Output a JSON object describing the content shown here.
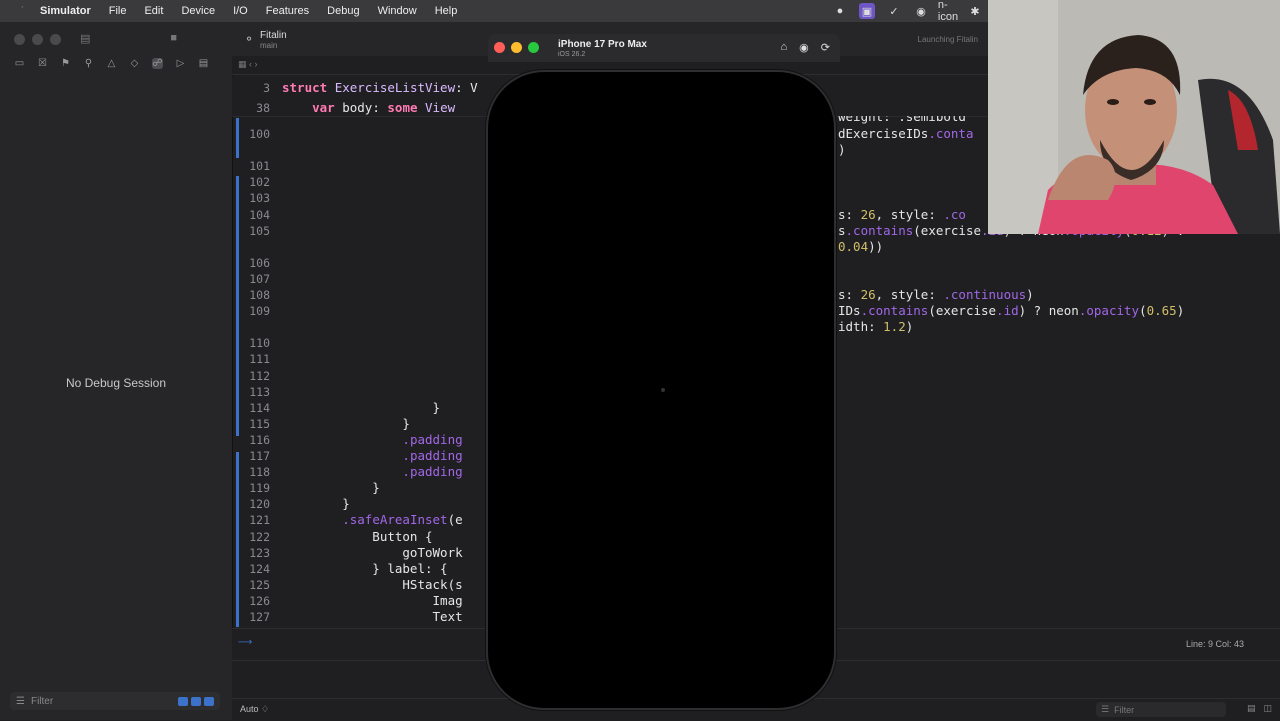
{
  "menubar": {
    "app": "Simulator",
    "items": [
      "File",
      "Edit",
      "Device",
      "I/O",
      "Features",
      "Debug",
      "Window",
      "Help"
    ],
    "status_icons": [
      "n-icon"
    ]
  },
  "navigator": {
    "no_debug": "No Debug Session",
    "filter_placeholder": "Filter"
  },
  "editor": {
    "project_name": "Fitalin",
    "branch": "main",
    "status": "Launching Fitalin",
    "sticky": [
      {
        "num": "3",
        "parts": [
          {
            "t": "struct ",
            "c": "kw"
          },
          {
            "t": "ExerciseListView",
            "c": "ty"
          },
          {
            "t": ": V",
            "c": ""
          }
        ]
      },
      {
        "num": "38",
        "parts": [
          {
            "t": "    var ",
            "c": "kw"
          },
          {
            "t": "body",
            "c": ""
          },
          {
            "t": ": ",
            "c": ""
          },
          {
            "t": "some ",
            "c": "kw"
          },
          {
            "t": "View",
            "c": "ty"
          }
        ]
      }
    ],
    "lines": [
      {
        "num": "100",
        "left": "",
        "right": "dExerciseIDs.conta"
      },
      {
        "num": "",
        "left": "",
        "right": ")"
      },
      {
        "num": "101",
        "left": "",
        "right": ""
      },
      {
        "num": "102",
        "left": "",
        "right": ""
      },
      {
        "num": "103",
        "left": "",
        "right": ""
      },
      {
        "num": "104",
        "left": "",
        "right": "s: 26, style: .co"
      },
      {
        "num": "105",
        "left": "",
        "right": "s.contains(exercise.id) ? neon.opacity(0.12) :"
      },
      {
        "num": "",
        "left": "",
        "right": "0.04))"
      },
      {
        "num": "106",
        "left": "",
        "right": ""
      },
      {
        "num": "107",
        "left": "",
        "right": ""
      },
      {
        "num": "108",
        "left": "",
        "right": "s: 26, style: .continuous)"
      },
      {
        "num": "109",
        "left": "",
        "right": "IDs.contains(exercise.id) ? neon.opacity(0.65)"
      },
      {
        "num": "",
        "left": "",
        "right": "idth: 1.2)"
      },
      {
        "num": "110",
        "left": "",
        "right": ""
      },
      {
        "num": "111",
        "left": "",
        "right": ""
      },
      {
        "num": "112",
        "left": "",
        "right": ""
      },
      {
        "num": "113",
        "left": "",
        "right": ""
      },
      {
        "num": "114",
        "left": "                    }",
        "right": ""
      },
      {
        "num": "115",
        "left": "                }",
        "right": ""
      },
      {
        "num": "116",
        "left": "                .padding",
        "right": ""
      },
      {
        "num": "117",
        "left": "                .padding",
        "right": ""
      },
      {
        "num": "118",
        "left": "                .padding",
        "right": ""
      },
      {
        "num": "119",
        "left": "            }",
        "right": ""
      },
      {
        "num": "120",
        "left": "        }",
        "right": ""
      },
      {
        "num": "121",
        "left": "        .safeAreaInset(e",
        "right": ""
      },
      {
        "num": "122",
        "left": "            Button {",
        "right": ""
      },
      {
        "num": "123",
        "left": "                goToWork",
        "right": ""
      },
      {
        "num": "124",
        "left": "            } label: {",
        "right": ""
      },
      {
        "num": "125",
        "left": "                HStack(s",
        "right": ""
      },
      {
        "num": "126",
        "left": "                    Imag",
        "right": ""
      },
      {
        "num": "127",
        "left": "                    Text",
        "right": ""
      }
    ],
    "partial_top_right": "weight: .semibold",
    "cursor_position": "Line: 9  Col: 43",
    "auto_label": "Auto ♢",
    "debug_filter_placeholder": "Filter"
  },
  "simulator": {
    "device": "iPhone 17 Pro Max",
    "os": "iOS 26.2",
    "traffic_colors": [
      "#ff5f57",
      "#febc2e",
      "#28c840"
    ]
  },
  "colors": {
    "accent": "#3c72c9",
    "keyword": "#ff7ab2",
    "type": "#dabaff",
    "number": "#d0bf69"
  }
}
